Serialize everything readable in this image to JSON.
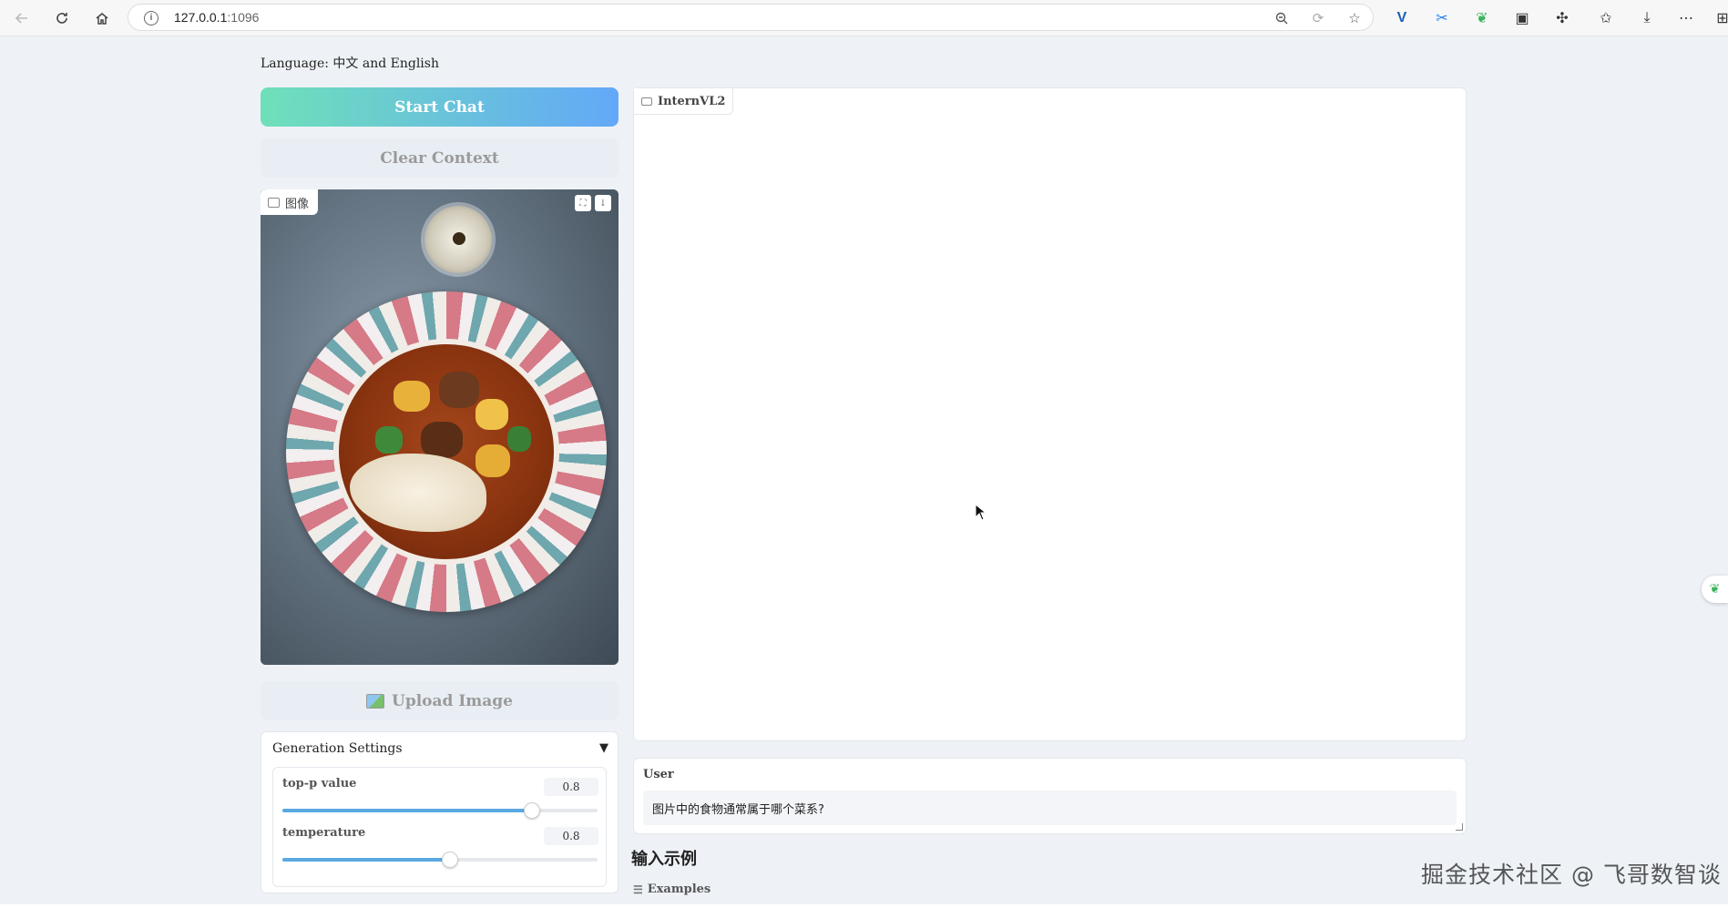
{
  "browser": {
    "url_host": "127.0.0.1",
    "url_port": ":1096"
  },
  "app": {
    "language_text": "Language: 中文 and English",
    "start_chat_label": "Start Chat",
    "clear_context_label": "Clear Context",
    "image_label": "图像",
    "upload_image_label": "Upload Image",
    "chat_label": "InternVL2",
    "user_label": "User",
    "user_input_value": "图片中的食物通常属于哪个菜系?",
    "examples_heading": "输入示例",
    "examples_label": "Examples",
    "watermark": "掘金技术社区 @ 飞哥数智谈"
  },
  "settings": {
    "title": "Generation Settings",
    "sliders": [
      {
        "label": "top-p value",
        "value": "0.8",
        "fraction": 0.79
      },
      {
        "label": "temperature",
        "value": "0.8",
        "fraction": 0.53
      }
    ]
  },
  "icons": {
    "back": "arrow-left-icon",
    "reload": "reload-icon",
    "home": "home-icon",
    "info": "info-icon",
    "zoom": "zoom-out-icon",
    "favorite": "star-icon",
    "extensions": "puzzle-icon",
    "menu": "more-icon"
  },
  "colors": {
    "start_gradient_left": "#6fe0b9",
    "start_gradient_right": "#63a8f8",
    "slider_fill": "#5aa8e0",
    "page_background": "#eef2f7"
  }
}
